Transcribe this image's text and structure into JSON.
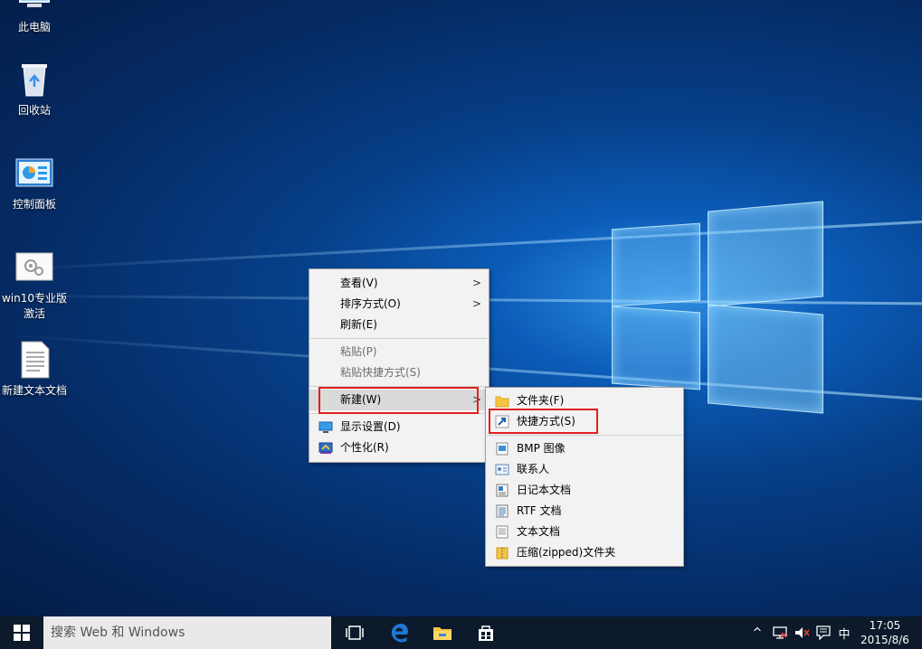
{
  "desktop_icons": [
    {
      "label": "此电脑",
      "icon": "this-pc-icon"
    },
    {
      "label": "回收站",
      "icon": "recycle-bin-icon"
    },
    {
      "label": "控制面板",
      "icon": "control-panel-icon"
    },
    {
      "label_line1": "win10专业版",
      "label_line2": "激活",
      "icon": "shortcut-file-icon"
    },
    {
      "label": "新建文本文档",
      "icon": "text-document-icon"
    }
  ],
  "context_menu": {
    "view": "查看(V)",
    "sort": "排序方式(O)",
    "refresh": "刷新(E)",
    "paste": "粘贴(P)",
    "paste_shortcut": "粘贴快捷方式(S)",
    "new": "新建(W)",
    "display_settings": "显示设置(D)",
    "personalize": "个性化(R)"
  },
  "new_submenu": {
    "folder": "文件夹(F)",
    "shortcut": "快捷方式(S)",
    "bmp": "BMP 图像",
    "contact": "联系人",
    "journal": "日记本文档",
    "rtf": "RTF 文档",
    "text": "文本文档",
    "zip": "压缩(zipped)文件夹"
  },
  "taskbar": {
    "search_placeholder": "搜索 Web 和 Windows",
    "ime": "中",
    "time": "17:05",
    "date": "2015/8/6"
  },
  "colors": {
    "highlight_box": "#e02020",
    "menu_bg": "#f2f2f2",
    "taskbar_bg": "#0c1a2b",
    "edge_blue": "#1e78d6"
  }
}
